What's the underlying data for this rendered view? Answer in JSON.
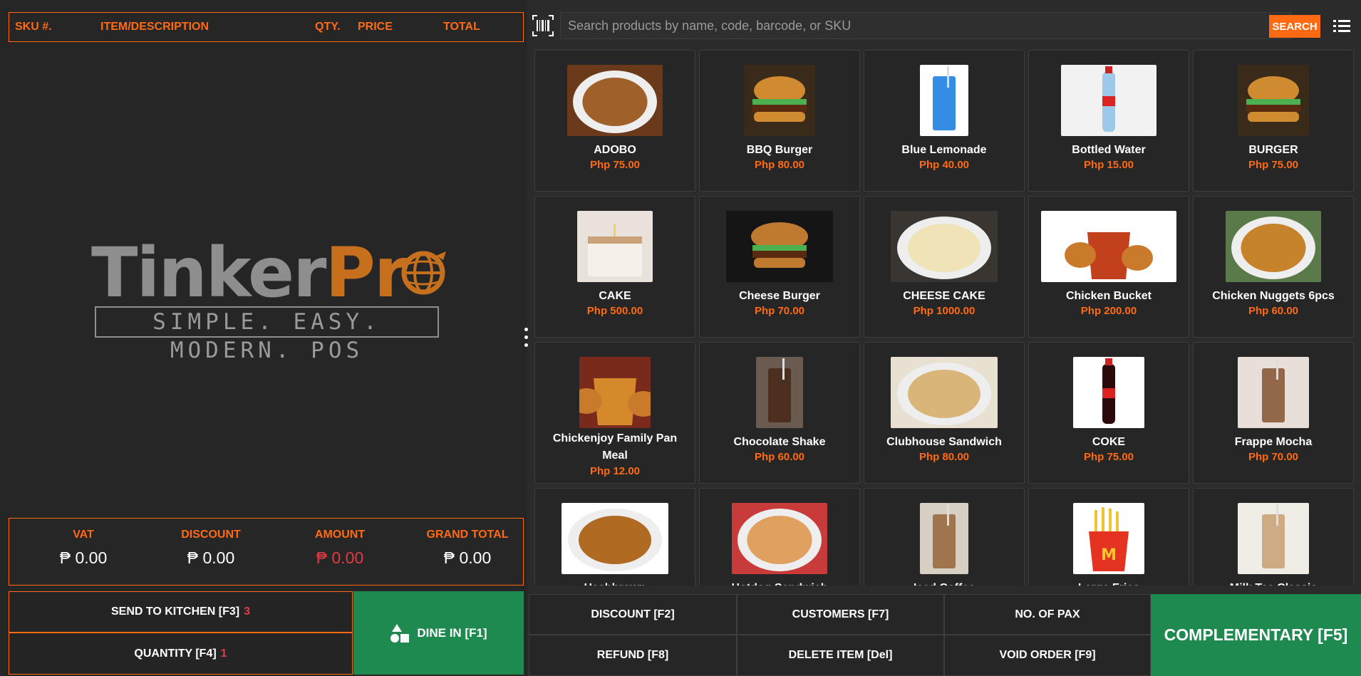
{
  "order_table": {
    "headers": [
      "SKU #.",
      "ITEM/DESCRIPTION",
      "QTY.",
      "PRICE",
      "TOTAL"
    ]
  },
  "logo": {
    "word_a": "Tinker",
    "word_b": "Pr",
    "tagline": "SIMPLE. EASY. MODERN. POS"
  },
  "totals": {
    "vat_label": "VAT",
    "vat_value": "₱ 0.00",
    "discount_label": "DISCOUNT",
    "discount_value": "₱ 0.00",
    "amount_label": "AMOUNT",
    "amount_value": "₱ 0.00",
    "grand_label": "GRAND TOTAL",
    "grand_value": "₱ 0.00"
  },
  "left_actions": {
    "send_kitchen": "SEND TO KITCHEN [F3]",
    "send_kitchen_count": "3",
    "quantity": "QUANTITY [F4]",
    "quantity_count": "1",
    "dine_in": "DINE IN [F1]"
  },
  "search": {
    "placeholder": "Search products by name, code, barcode, or SKU",
    "button": "SEARCH"
  },
  "products": [
    {
      "name": "ADOBO",
      "price": "Php 75.00",
      "img": "adobo"
    },
    {
      "name": "BBQ Burger",
      "price": "Php 80.00",
      "img": "burger"
    },
    {
      "name": "Blue Lemonade",
      "price": "Php 40.00",
      "img": "lemonade"
    },
    {
      "name": "Bottled Water",
      "price": "Php 15.00",
      "img": "water"
    },
    {
      "name": "BURGER",
      "price": "Php 75.00",
      "img": "burger"
    },
    {
      "name": "CAKE",
      "price": "Php 500.00",
      "img": "cake"
    },
    {
      "name": "Cheese Burger",
      "price": "Php 70.00",
      "img": "burger-dark"
    },
    {
      "name": "CHEESE CAKE",
      "price": "Php 1000.00",
      "img": "cheesecake"
    },
    {
      "name": "Chicken Bucket",
      "price": "Php 200.00",
      "img": "bucket"
    },
    {
      "name": "Chicken Nuggets 6pcs",
      "price": "Php 60.00",
      "img": "nuggets"
    },
    {
      "name": "Chickenjoy Family Pan Meal",
      "price": "Php 12.00",
      "img": "chickenjoy"
    },
    {
      "name": "Chocolate Shake",
      "price": "Php 60.00",
      "img": "shake"
    },
    {
      "name": "Clubhouse Sandwich",
      "price": "Php 80.00",
      "img": "sandwich"
    },
    {
      "name": "COKE",
      "price": "Php 75.00",
      "img": "coke"
    },
    {
      "name": "Frappe Mocha",
      "price": "Php 70.00",
      "img": "frappe"
    },
    {
      "name": "Hashbrown",
      "price": "",
      "img": "hashbrown"
    },
    {
      "name": "Hotdog Sandwich",
      "price": "",
      "img": "hotdog"
    },
    {
      "name": "Iced Coffee",
      "price": "",
      "img": "icedcoffee"
    },
    {
      "name": "Large Fries",
      "price": "",
      "img": "fries"
    },
    {
      "name": "Milk Tea Classic",
      "price": "",
      "img": "milktea"
    }
  ],
  "right_actions": {
    "discount": "DISCOUNT [F2]",
    "customers": "CUSTOMERS [F7]",
    "pax": "NO. OF PAX",
    "refund": "REFUND [F8]",
    "delete": "DELETE ITEM [Del]",
    "void": "VOID ORDER [F9]",
    "complementary": "COMPLEMENTARY [F5]"
  },
  "colors": {
    "accent": "#ff6a13",
    "green": "#1f8a4f",
    "red": "#e23b45",
    "panel": "#262626"
  }
}
